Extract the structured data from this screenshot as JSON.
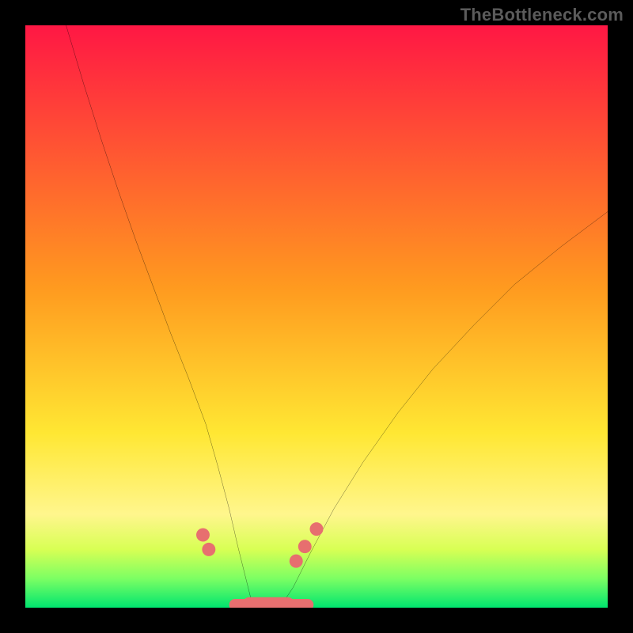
{
  "watermark": "TheBottleneck.com",
  "chart_data": {
    "type": "line",
    "title": "",
    "xlabel": "",
    "ylabel": "",
    "xlim": [
      0,
      100
    ],
    "ylim": [
      0,
      100
    ],
    "grid": false,
    "legend": false,
    "background_gradient": {
      "stops": [
        {
          "offset": 0.0,
          "color": "#ff1744"
        },
        {
          "offset": 0.45,
          "color": "#ff9a1f"
        },
        {
          "offset": 0.7,
          "color": "#ffe733"
        },
        {
          "offset": 0.84,
          "color": "#fff68d"
        },
        {
          "offset": 0.9,
          "color": "#d8ff54"
        },
        {
          "offset": 0.95,
          "color": "#7cff63"
        },
        {
          "offset": 1.0,
          "color": "#00e56f"
        }
      ]
    },
    "series": [
      {
        "name": "left-branch",
        "color": "#000000",
        "x": [
          7.0,
          10.0,
          13.0,
          16.0,
          19.0,
          22.0,
          25.0,
          28.0,
          31.0,
          33.0,
          35.0,
          36.5,
          38.0,
          39.0
        ],
        "y": [
          100.0,
          90.0,
          80.5,
          71.5,
          63.0,
          55.0,
          47.0,
          39.5,
          31.5,
          24.5,
          17.0,
          10.5,
          4.5,
          0.5
        ]
      },
      {
        "name": "right-branch",
        "color": "#000000",
        "x": [
          44.0,
          46.0,
          49.0,
          53.0,
          58.0,
          64.0,
          70.0,
          77.0,
          84.0,
          92.0,
          100.0
        ],
        "y": [
          0.5,
          3.5,
          9.5,
          17.0,
          25.0,
          33.5,
          41.0,
          48.5,
          55.5,
          62.0,
          68.0
        ]
      }
    ],
    "floor_segments": [
      {
        "name": "left-floor",
        "color": "#e76f6f",
        "x": [
          36.0,
          39.0
        ],
        "y": [
          0.5,
          0.5
        ],
        "capsule": false
      },
      {
        "name": "mid-floor",
        "color": "#e76f6f",
        "x": [
          38.5,
          45.0
        ],
        "y": [
          0.5,
          0.5
        ],
        "capsule": true
      },
      {
        "name": "right-floor",
        "color": "#e76f6f",
        "x": [
          44.5,
          48.5
        ],
        "y": [
          0.5,
          0.5
        ],
        "capsule": false
      }
    ],
    "markers": [
      {
        "name": "left-dot-1",
        "x": 30.5,
        "y": 12.5,
        "color": "#e76f6f"
      },
      {
        "name": "left-dot-2",
        "x": 31.5,
        "y": 10.0,
        "color": "#e76f6f"
      },
      {
        "name": "right-dot-1",
        "x": 46.5,
        "y": 8.0,
        "color": "#e76f6f"
      },
      {
        "name": "right-dot-2",
        "x": 48.0,
        "y": 10.5,
        "color": "#e76f6f"
      },
      {
        "name": "right-dot-3",
        "x": 50.0,
        "y": 13.5,
        "color": "#e76f6f"
      }
    ]
  }
}
